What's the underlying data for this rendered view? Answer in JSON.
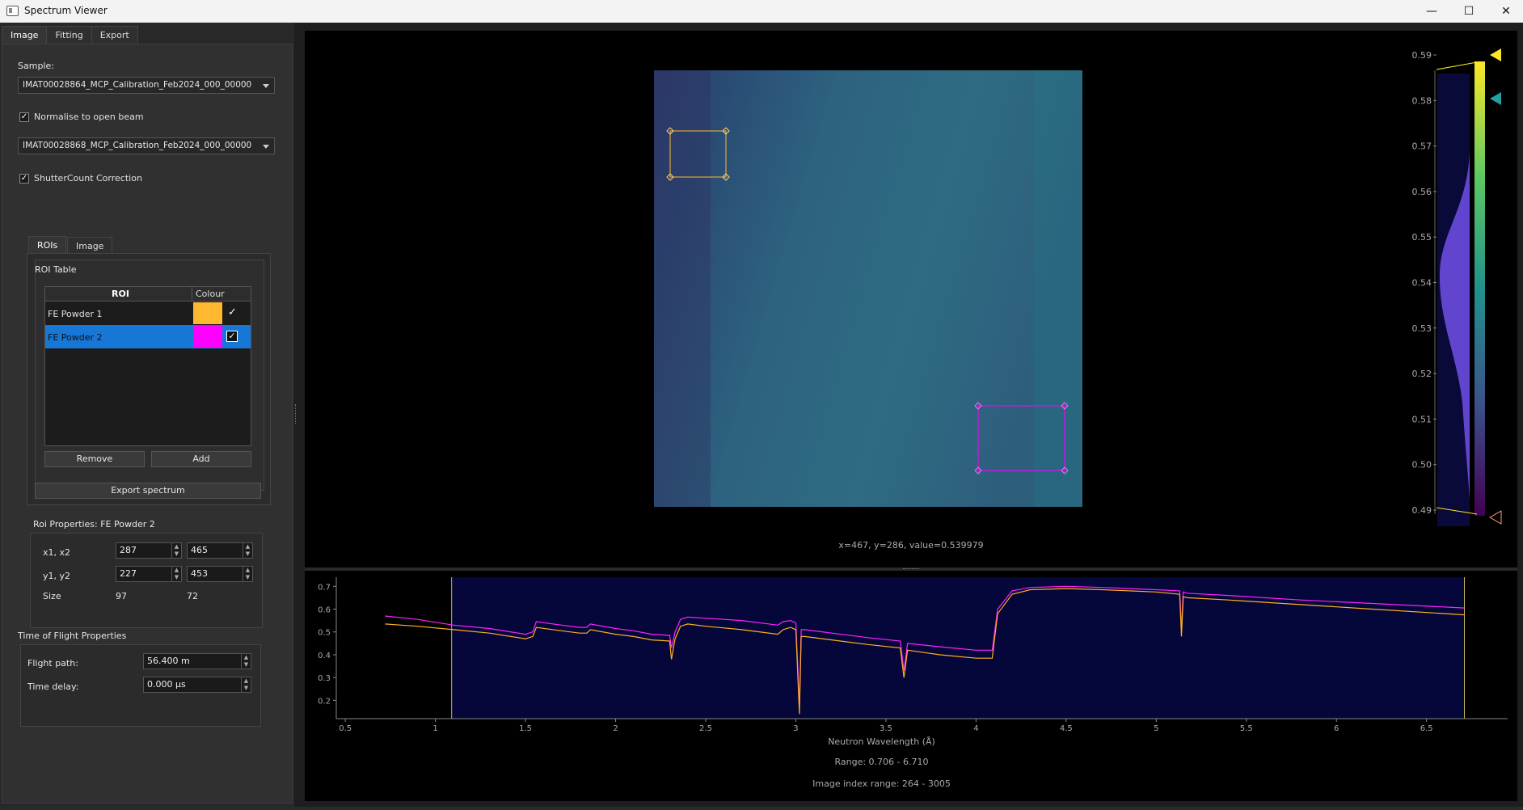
{
  "window": {
    "title": "Spectrum Viewer",
    "minimize": "—",
    "maximize": "☐",
    "close": "✕"
  },
  "main_tabs": [
    {
      "label": "Image"
    },
    {
      "label": "Fitting"
    },
    {
      "label": "Export"
    }
  ],
  "image_tab": {
    "sample_label": "Sample:",
    "sample_value": "IMAT00028864_MCP_Calibration_Feb2024_000_00000",
    "normalise_label": "Normalise to open beam",
    "normalise_checked": true,
    "open_beam_value": "IMAT00028868_MCP_Calibration_Feb2024_000_00000",
    "shutter_label": "ShutterCount Correction",
    "shutter_checked": true,
    "sub_tabs": [
      {
        "label": "ROIs"
      },
      {
        "label": "Image"
      }
    ],
    "roi_table_title": "ROI Table",
    "roi_columns": {
      "roi": "ROI",
      "colour": "Colour"
    },
    "rois": [
      {
        "name": "FE Powder 1",
        "colour": "#ffb830",
        "visible": true,
        "selected": false
      },
      {
        "name": "FE Powder 2",
        "colour": "#ff00ff",
        "visible": true,
        "selected": true
      }
    ],
    "remove_label": "Remove",
    "add_label": "Add",
    "export_label": "Export spectrum",
    "roi_props_title": "Roi Properties: FE Powder 2",
    "x_label": "x1, x2",
    "x1": "287",
    "x2": "465",
    "y_label": "y1, y2",
    "y1": "227",
    "y2": "453",
    "size_label": "Size",
    "size_w": "97",
    "size_h": "72",
    "tof_title": "Time of Flight Properties",
    "flight_path_label": "Flight path:",
    "flight_path_value": "56.400 m",
    "time_delay_label": "Time delay:",
    "time_delay_value": "0.000 µs"
  },
  "image_view": {
    "coords_text": "x=467, y=286, value=0.539979",
    "colorbar_ticks": [
      "0.59",
      "0.58",
      "0.57",
      "0.56",
      "0.55",
      "0.54",
      "0.53",
      "0.52",
      "0.51",
      "0.50",
      "0.49"
    ]
  },
  "spectrum": {
    "xlabel": "Neutron Wavelength (Å)",
    "range_text": "Range: 0.706 - 6.710",
    "index_text": "Image index range: 264 - 3005"
  },
  "chart_data": {
    "type": "line",
    "xlim": [
      0.45,
      6.95
    ],
    "ylim": [
      0.12,
      0.74
    ],
    "xticks": [
      "0.5",
      "1",
      "1.5",
      "2",
      "2.5",
      "3",
      "3.5",
      "4",
      "4.5",
      "5",
      "5.5",
      "6",
      "6.5"
    ],
    "yticks": [
      "0.2",
      "0.3",
      "0.4",
      "0.5",
      "0.6",
      "0.7"
    ],
    "xlabel": "Neutron Wavelength (Å)",
    "range": [
      1.09,
      6.71
    ],
    "series": [
      {
        "color": "#ff22ff",
        "x": [
          0.72,
          0.9,
          1.1,
          1.3,
          1.5,
          1.54,
          1.56,
          1.7,
          1.8,
          1.84,
          1.86,
          2.0,
          2.1,
          2.2,
          2.3,
          2.31,
          2.33,
          2.36,
          2.4,
          2.5,
          2.7,
          2.9,
          2.93,
          2.97,
          3.0,
          3.02,
          3.03,
          3.05,
          3.2,
          3.4,
          3.58,
          3.6,
          3.62,
          3.8,
          4.0,
          4.09,
          4.12,
          4.2,
          4.3,
          4.5,
          4.7,
          5.0,
          5.13,
          5.14,
          5.15,
          5.17,
          5.4,
          5.8,
          6.2,
          6.71
        ],
        "y": [
          0.57,
          0.555,
          0.53,
          0.515,
          0.49,
          0.5,
          0.545,
          0.53,
          0.52,
          0.52,
          0.535,
          0.515,
          0.505,
          0.49,
          0.485,
          0.43,
          0.5,
          0.555,
          0.565,
          0.56,
          0.55,
          0.53,
          0.545,
          0.55,
          0.54,
          0.18,
          0.51,
          0.51,
          0.495,
          0.475,
          0.46,
          0.33,
          0.45,
          0.435,
          0.42,
          0.42,
          0.6,
          0.68,
          0.695,
          0.7,
          0.695,
          0.685,
          0.68,
          0.52,
          0.675,
          0.67,
          0.66,
          0.64,
          0.625,
          0.605
        ]
      },
      {
        "color": "#ffb020",
        "x": [
          0.72,
          0.9,
          1.1,
          1.3,
          1.5,
          1.54,
          1.56,
          1.7,
          1.8,
          1.84,
          1.86,
          2.0,
          2.1,
          2.2,
          2.3,
          2.31,
          2.33,
          2.36,
          2.4,
          2.5,
          2.7,
          2.9,
          2.93,
          2.97,
          3.0,
          3.02,
          3.03,
          3.05,
          3.2,
          3.4,
          3.58,
          3.6,
          3.62,
          3.8,
          4.0,
          4.09,
          4.12,
          4.2,
          4.3,
          4.5,
          4.7,
          5.0,
          5.13,
          5.14,
          5.15,
          5.17,
          5.4,
          5.8,
          6.2,
          6.71
        ],
        "y": [
          0.535,
          0.525,
          0.51,
          0.495,
          0.47,
          0.48,
          0.52,
          0.505,
          0.495,
          0.495,
          0.51,
          0.49,
          0.48,
          0.465,
          0.46,
          0.38,
          0.47,
          0.525,
          0.535,
          0.525,
          0.51,
          0.49,
          0.51,
          0.52,
          0.51,
          0.14,
          0.48,
          0.48,
          0.465,
          0.445,
          0.43,
          0.3,
          0.42,
          0.4,
          0.385,
          0.385,
          0.58,
          0.665,
          0.685,
          0.69,
          0.685,
          0.675,
          0.665,
          0.48,
          0.655,
          0.65,
          0.64,
          0.62,
          0.6,
          0.575
        ]
      }
    ]
  }
}
